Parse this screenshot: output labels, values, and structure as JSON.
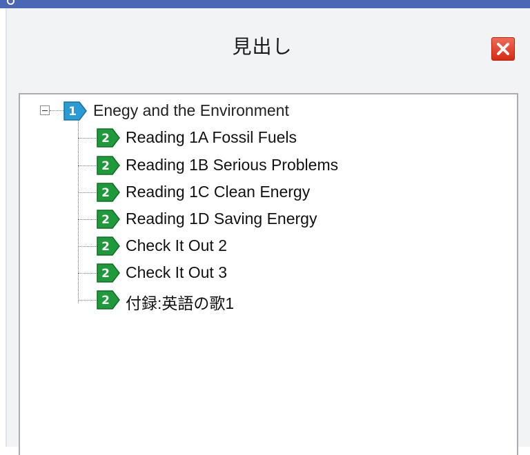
{
  "panel": {
    "title": "見出し",
    "close_icon": "close-icon",
    "accent_close": "#d72a12"
  },
  "outline": {
    "root": {
      "level": "1",
      "label": "Enegy and the Environment",
      "badge_color": "#2b9bd6",
      "expanded": true
    },
    "children": [
      {
        "level": "2",
        "label": "Reading 1A Fossil Fuels"
      },
      {
        "level": "2",
        "label": "Reading 1B Serious Problems"
      },
      {
        "level": "2",
        "label": "Reading 1C Clean Energy"
      },
      {
        "level": "2",
        "label": "Reading 1D Saving Energy"
      },
      {
        "level": "2",
        "label": "Check It Out 2"
      },
      {
        "level": "2",
        "label": "Check It Out 3"
      },
      {
        "level": "2",
        "label": "付録:英語の歌1"
      }
    ],
    "child_badge_color": "#1f9a3a"
  }
}
